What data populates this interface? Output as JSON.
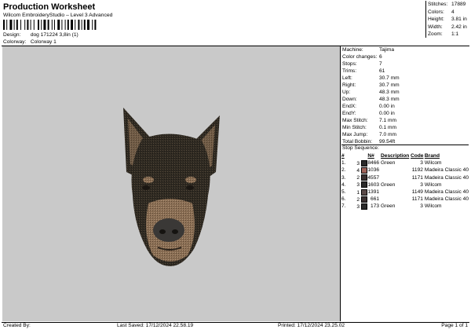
{
  "header": {
    "title": "Production Worksheet",
    "subtitle": "Wilcom EmbroideryStudio – Level 3 Advanced",
    "design_label": "Design:",
    "design_value": "dog 171224 3,8in (1)",
    "colorway_label": "Colorway:",
    "colorway_value": "Colorway 1"
  },
  "summary": [
    {
      "label": "Stitches:",
      "value": "17889"
    },
    {
      "label": "Colors:",
      "value": "4"
    },
    {
      "label": "Height:",
      "value": "3.81 in"
    },
    {
      "label": "Width:",
      "value": "2.42 in"
    },
    {
      "label": "Zoom:",
      "value": "1:1"
    }
  ],
  "machine_info": [
    {
      "label": "Machine:",
      "value": "Tajima"
    },
    {
      "label": "Color changes:",
      "value": "6"
    },
    {
      "label": "Stops:",
      "value": "7"
    },
    {
      "label": "Trims:",
      "value": "61"
    },
    {
      "label": "Left:",
      "value": "30.7 mm"
    },
    {
      "label": "Right:",
      "value": "30.7 mm"
    },
    {
      "label": "Up:",
      "value": "48.3 mm"
    },
    {
      "label": "Down:",
      "value": "48.3 mm"
    },
    {
      "label": "EndX:",
      "value": "0.00 in"
    },
    {
      "label": "EndY:",
      "value": "0.00 in"
    },
    {
      "label": "Max Stitch:",
      "value": "7.1 mm"
    },
    {
      "label": "Min Stitch:",
      "value": "0.1 mm"
    },
    {
      "label": "Max Jump:",
      "value": "7.0 mm"
    },
    {
      "label": "Total Bobbin:",
      "value": "99.54ft"
    }
  ],
  "stop_sequence": {
    "title": "Stop Sequence:",
    "columns": {
      "hash": "#",
      "n": "N#",
      "description": "Description",
      "code": "Code",
      "brand": "Brand"
    },
    "rows": [
      {
        "stop": "1.",
        "color_no": "3",
        "color": "#2b2b2b",
        "n": "8466",
        "description": "Green",
        "code": "3",
        "brand": "Wilcom"
      },
      {
        "stop": "2.",
        "color_no": "4",
        "color": "#a0645a",
        "n": "1036",
        "description": "",
        "code": "1192",
        "brand": "Madeira Classic 40"
      },
      {
        "stop": "3.",
        "color_no": "2",
        "color": "#3a3030",
        "n": "4557",
        "description": "",
        "code": "1171",
        "brand": "Madeira Classic 40"
      },
      {
        "stop": "4.",
        "color_no": "3",
        "color": "#2b2b2b",
        "n": "1603",
        "description": "Green",
        "code": "3",
        "brand": "Wilcom"
      },
      {
        "stop": "5.",
        "color_no": "1",
        "color": "#5a4a48",
        "n": "1391",
        "description": "",
        "code": "1149",
        "brand": "Madeira Classic 40"
      },
      {
        "stop": "6.",
        "color_no": "2",
        "color": "#3a3030",
        "n": "661",
        "description": "",
        "code": "1171",
        "brand": "Madeira Classic 40"
      },
      {
        "stop": "7.",
        "color_no": "3",
        "color": "#2b2b2b",
        "n": "173",
        "description": "Green",
        "code": "3",
        "brand": "Wilcom"
      }
    ]
  },
  "footer": {
    "created_by": "Created By:",
    "last_saved": "Last Saved: 17/12/2024 22.58.19",
    "printed": "Printed: 17/12/2024 23.25.02",
    "page": "Page 1 of 1"
  },
  "colors": {
    "canvas_bg": "#c9c9c9",
    "fur_dark": "#2f2a22",
    "fur_tan": "#8a6e54",
    "nose": "#3a3836"
  }
}
